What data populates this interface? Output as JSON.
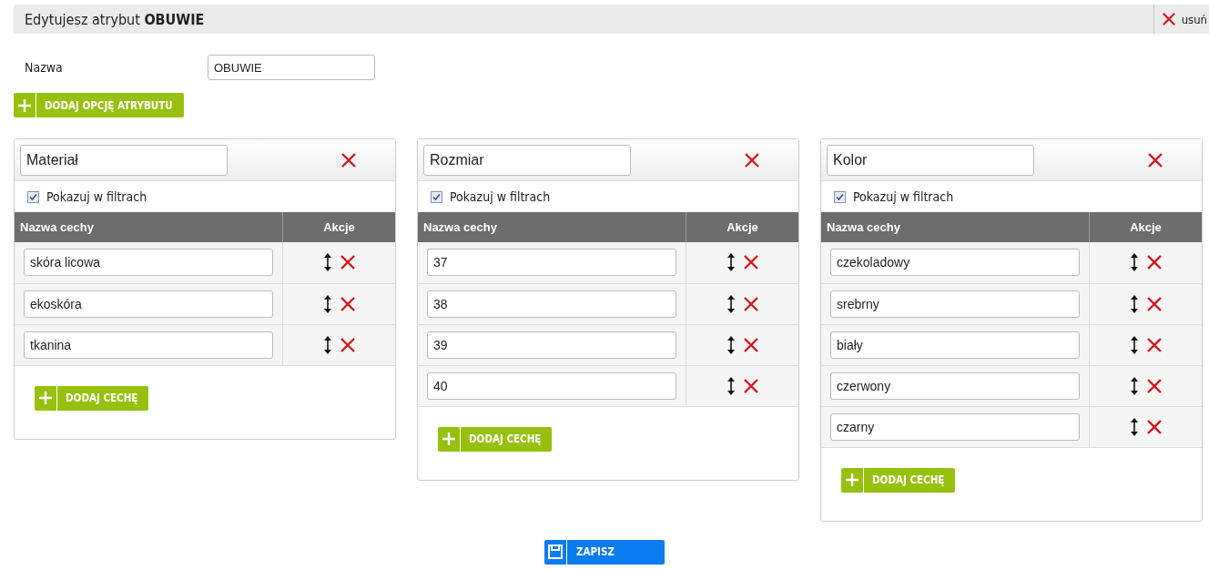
{
  "header": {
    "title_prefix": "Edytujesz atrybut ",
    "title_name": "OBUWIE",
    "delete_label": "usuń"
  },
  "name_field": {
    "label": "Nazwa",
    "value": "OBUWIE"
  },
  "add_option_button": "DODAJ OPCJĘ ATRYBUTU",
  "options": [
    {
      "name": "Materiał",
      "show_in_filters": {
        "label": "Pokazuj w filtrach",
        "checked": true
      },
      "columns": [
        "Nazwa cechy",
        "Akcje"
      ],
      "features": [
        "skóra licowa",
        "ekoskóra",
        "tkanina"
      ],
      "add_feature_button": "DODAJ CECHĘ"
    },
    {
      "name": "Rozmiar",
      "show_in_filters": {
        "label": "Pokazuj w filtrach",
        "checked": true
      },
      "columns": [
        "Nazwa cechy",
        "Akcje"
      ],
      "features": [
        "37",
        "38",
        "39",
        "40"
      ],
      "add_feature_button": "DODAJ CECHĘ"
    },
    {
      "name": "Kolor",
      "show_in_filters": {
        "label": "Pokazuj w filtrach",
        "checked": true
      },
      "columns": [
        "Nazwa cechy",
        "Akcje"
      ],
      "features": [
        "czekoladowy",
        "srebrny",
        "biały",
        "czerwony",
        "czarny"
      ],
      "add_feature_button": "DODAJ CECHĘ"
    }
  ],
  "save_button": "ZAPISZ"
}
